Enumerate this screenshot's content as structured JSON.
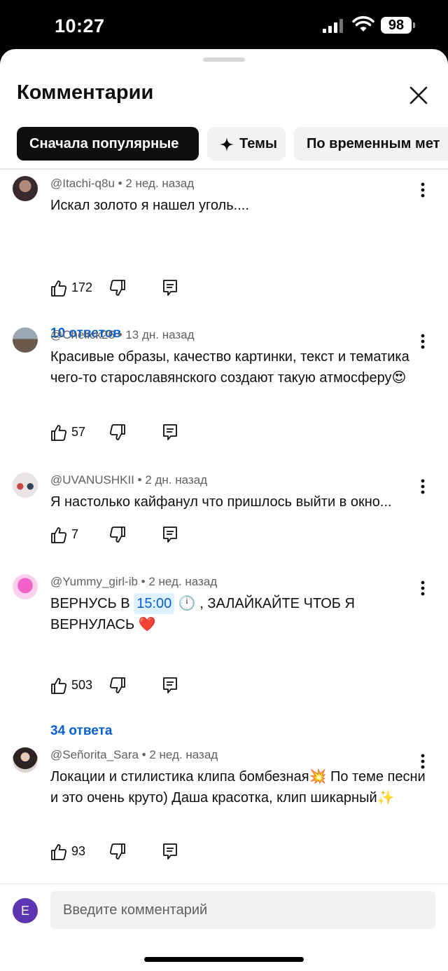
{
  "status": {
    "time": "10:27",
    "battery": "98"
  },
  "header": {
    "title": "Комментарии"
  },
  "chips": [
    {
      "label": "Сначала популярные"
    },
    {
      "label": "Темы"
    },
    {
      "label": "По временным мет"
    }
  ],
  "comments": [
    {
      "author": "@Itachi-q8u",
      "age": "2 нед. назад",
      "text": "Искал золото я нашел уголь....",
      "likes": "172",
      "replies": "10 ответов"
    },
    {
      "author": "@Chelick26",
      "age": "13 дн. назад",
      "text": "Красивые образы, качество картинки, текст и тематика чего-то старославянского создают такую атмосферу😍",
      "likes": "57"
    },
    {
      "author": "@UVANUSHKII",
      "age": "2 дн. назад",
      "text": "Я настолько кайфанул что пришлось выйти в окно...",
      "likes": "7"
    },
    {
      "author": "@Yummy_girl-ib",
      "age": "2 нед. назад",
      "text_before": "ВЕРНУСЬ В ",
      "timestamp": "15:00",
      "text_after": " 🕛 , ЗАЛАЙКАЙТЕ ЧТОБ Я ВЕРНУЛАСЬ ❤️",
      "likes": "503",
      "replies": "34 ответа"
    },
    {
      "author": "@Señorita_Sara",
      "age": "2 нед. назад",
      "text": "Локации и стилистика клипа бомбезная💥 По теме песни и это очень круто) Даша красотка, клип шикарный✨",
      "likes": "93"
    }
  ],
  "composer": {
    "avatar_letter": "E",
    "placeholder": "Введите комментарий"
  },
  "colors": {
    "link": "#065fd4",
    "chip_active": "#0f0f0f",
    "avatar_self": "#5e35b1"
  }
}
